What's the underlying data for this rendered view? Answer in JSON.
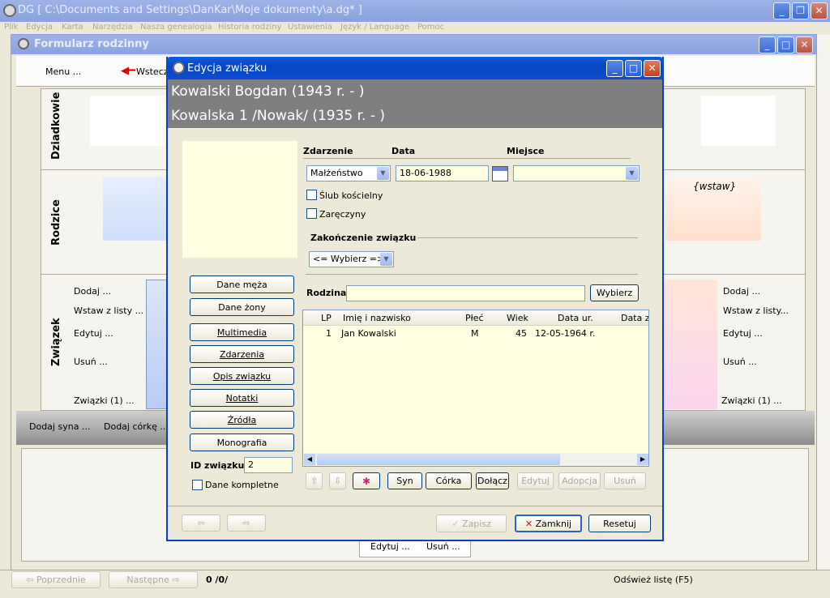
{
  "main_window": {
    "title": "DG [ C:\\Documents and Settings\\DanKar\\Moje dokumenty\\a.dg* ]",
    "menu": [
      "Plik",
      "Edycja",
      "Karta",
      "Narzędzia",
      "Nasza genealogia",
      "Historia rodziny",
      "Ustawienia",
      "Język / Language",
      "Pomoc"
    ],
    "bottom": {
      "prev_label": "⇦ Poprzednie",
      "next_label": "Następne ⇨",
      "counter": "0 /0/",
      "refresh_label": "Odśwież listę (F5)"
    }
  },
  "family_form": {
    "title": "Formularz rodzinny",
    "menu_label": "Menu ...",
    "back_label": "Wstecz",
    "sections": {
      "grandparents": "Dziadkowie",
      "parents": "Rodzice",
      "union": "Związek"
    },
    "insert_label": "{wstaw}",
    "left_actions": [
      "Dodaj ...",
      "Wstaw z listy ...",
      "Edytuj ...",
      "Usuń ...",
      "Związki (1) ..."
    ],
    "right_actions": [
      "Dodaj ...",
      "Wstaw z listy...",
      "Edytuj ...",
      "Usuń ...",
      "Związki (1) ..."
    ],
    "bottom_bar": [
      "Dodaj syna ...",
      "Dodaj córkę ..."
    ],
    "child_actions": [
      "Edytuj ...",
      "Usuń ..."
    ]
  },
  "dialog": {
    "title": "Edycja związku",
    "person1": "Kowalski Bogdan (1943 r. - )",
    "person2": "Kowalska 1 /Nowak/ (1935 r. - )",
    "side_buttons": [
      "Dane męża",
      "Dane żony",
      "Multimedia",
      "Zdarzenia",
      "Opis związku",
      "Notatki",
      "Źródła",
      "Monografia"
    ],
    "id_label": "ID związku",
    "id_value": "2",
    "complete_label": "Dane kompletne",
    "event": {
      "col_event": "Zdarzenie",
      "col_date": "Data",
      "col_place": "Miejsce",
      "event_value": "Małżeństwo",
      "date_value": "18-06-1988",
      "place_value": ""
    },
    "church_wedding_label": "Ślub kościelny",
    "engagement_label": "Zaręczyny",
    "end_section_label": "Zakończenie związku",
    "end_select_value": "<= Wybierz =>",
    "family_label": "Rodzina",
    "family_value": "",
    "choose_label": "Wybierz",
    "table": {
      "headers": [
        "LP",
        "Imię i nazwisko",
        "Płeć",
        "Wiek",
        "Data ur.",
        "Data zg"
      ],
      "rows": [
        [
          "1",
          "Jan Kowalski",
          "M",
          "45",
          "12-05-1964 r.",
          ""
        ]
      ]
    },
    "table_buttons": {
      "son": "Syn",
      "daughter": "Córka",
      "attach": "Dołącz",
      "edit": "Edytuj",
      "adoption": "Adopcja",
      "delete": "Usuń"
    },
    "footer": {
      "save": "Zapisz",
      "close": "Zamknij",
      "reset": "Resetuj"
    }
  }
}
